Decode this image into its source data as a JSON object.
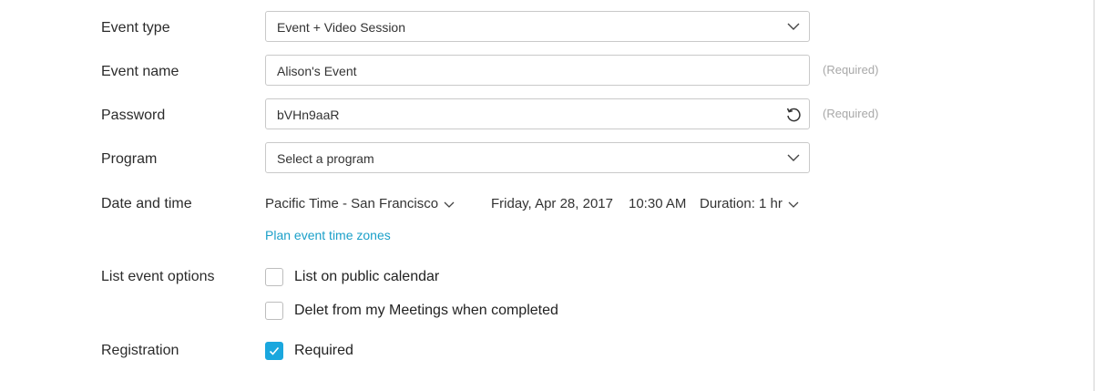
{
  "form": {
    "event_type": {
      "label": "Event type",
      "value": "Event + Video Session"
    },
    "event_name": {
      "label": "Event name",
      "value": "Alison's Event",
      "required": "(Required)"
    },
    "password": {
      "label": "Password",
      "value": "bVHn9aaR",
      "required": "(Required)"
    },
    "program": {
      "label": "Program",
      "placeholder": "Select a program"
    },
    "date_time": {
      "label": "Date and time",
      "timezone": "Pacific Time - San Francisco",
      "date": "Friday, Apr 28, 2017",
      "time": "10:30 AM",
      "duration": "Duration: 1 hr",
      "plan_link": "Plan event time zones"
    },
    "list_options": {
      "label": "List event options",
      "public_calendar": {
        "label": "List on public calendar",
        "checked": false
      },
      "delete_completed": {
        "label": "Delet from my Meetings when completed",
        "checked": false
      }
    },
    "registration": {
      "label": "Registration",
      "required": {
        "label": "Required",
        "checked": true
      }
    }
  },
  "colors": {
    "accent": "#1aa7de",
    "link": "#1ba0c9",
    "required_hint": "#a8a8a8",
    "border": "#c9c9c9"
  },
  "icons": {
    "dropdown": "chevron-down-icon",
    "regenerate": "refresh-icon",
    "check": "checkmark-icon"
  }
}
